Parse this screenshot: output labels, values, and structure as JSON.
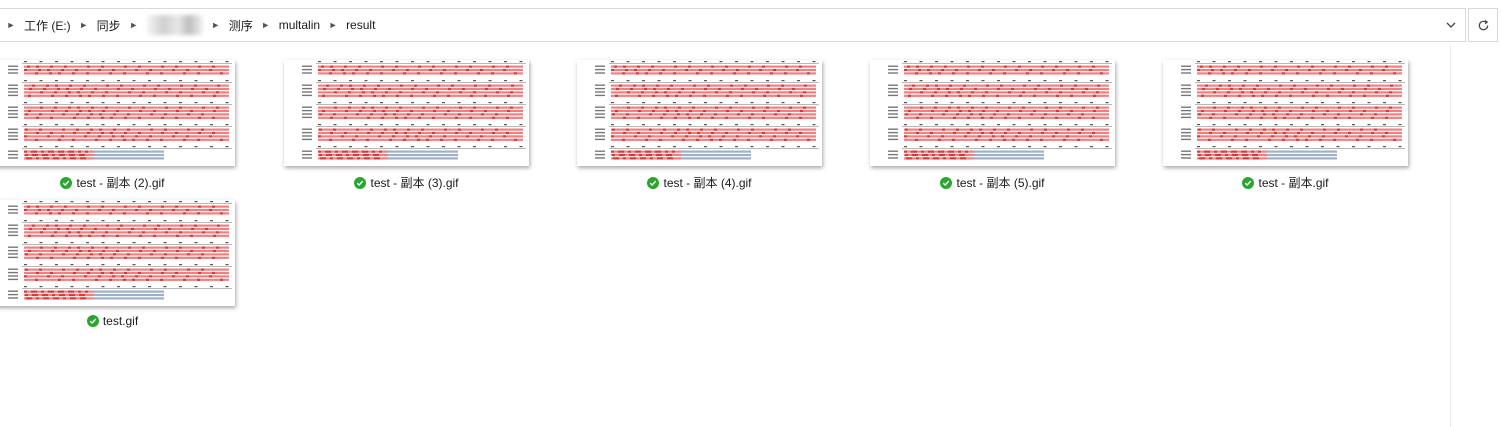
{
  "breadcrumb": {
    "items": [
      "工作 (E:)",
      "同步",
      "",
      "测序",
      "multalin",
      "result"
    ]
  },
  "icons": {
    "separator": "chevron-right-icon",
    "dropdown": "chevron-down-icon",
    "refresh": "refresh-icon",
    "sync": "sync-ok-icon"
  },
  "colors": {
    "sync_ok": "#2aa52f",
    "alignment_high": "#f08080",
    "alignment_low": "#9db0c8"
  },
  "files": [
    {
      "name": "test - 副本 (2).gif"
    },
    {
      "name": "test - 副本 (3).gif"
    },
    {
      "name": "test - 副本 (4).gif"
    },
    {
      "name": "test - 副本 (5).gif"
    },
    {
      "name": "test - 副本.gif"
    },
    {
      "name": "test.gif"
    }
  ]
}
